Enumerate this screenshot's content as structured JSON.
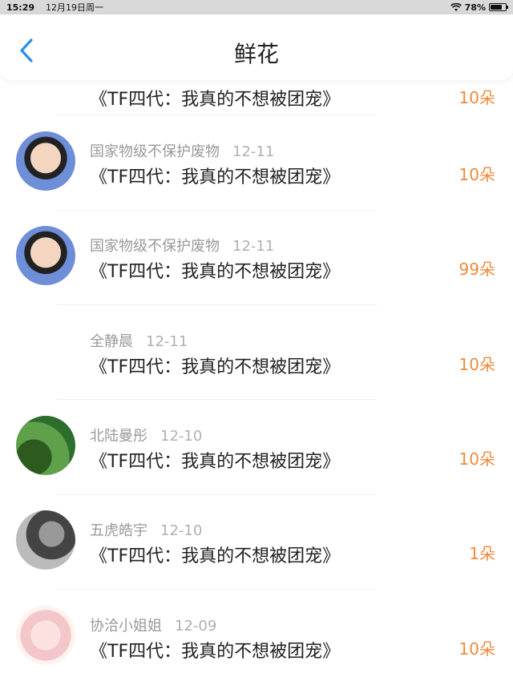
{
  "status_bar": {
    "time": "15:29",
    "date": "12月19日周一",
    "battery": "78%",
    "battery_level": 0.78
  },
  "nav": {
    "title": "鲜花",
    "back_icon": "chevron-left-icon",
    "accent": "#2a8df0"
  },
  "list": {
    "partial_row": {
      "book": "《TF四代：我真的不想被团宠》",
      "amount": "10朵"
    },
    "rows": [
      {
        "user": "国家物级不保护废物",
        "date": "12-11",
        "book": "《TF四代：我真的不想被团宠》",
        "amount": "10朵"
      },
      {
        "user": "国家物级不保护废物",
        "date": "12-11",
        "book": "《TF四代：我真的不想被团宠》",
        "amount": "99朵"
      },
      {
        "user": "全静晨",
        "date": "12-11",
        "book": "《TF四代：我真的不想被团宠》",
        "amount": "10朵"
      },
      {
        "user": "北陆曼彤",
        "date": "12-10",
        "book": "《TF四代：我真的不想被团宠》",
        "amount": "10朵"
      },
      {
        "user": "五虎皓宇",
        "date": "12-10",
        "book": "《TF四代：我真的不想被团宠》",
        "amount": "1朵"
      },
      {
        "user": "协洽小姐姐",
        "date": "12-09",
        "book": "《TF四代：我真的不想被团宠》",
        "amount": "10朵"
      }
    ]
  },
  "colors": {
    "amount": "#f08a3c",
    "username": "#9a9a9a",
    "title": "#222222"
  }
}
